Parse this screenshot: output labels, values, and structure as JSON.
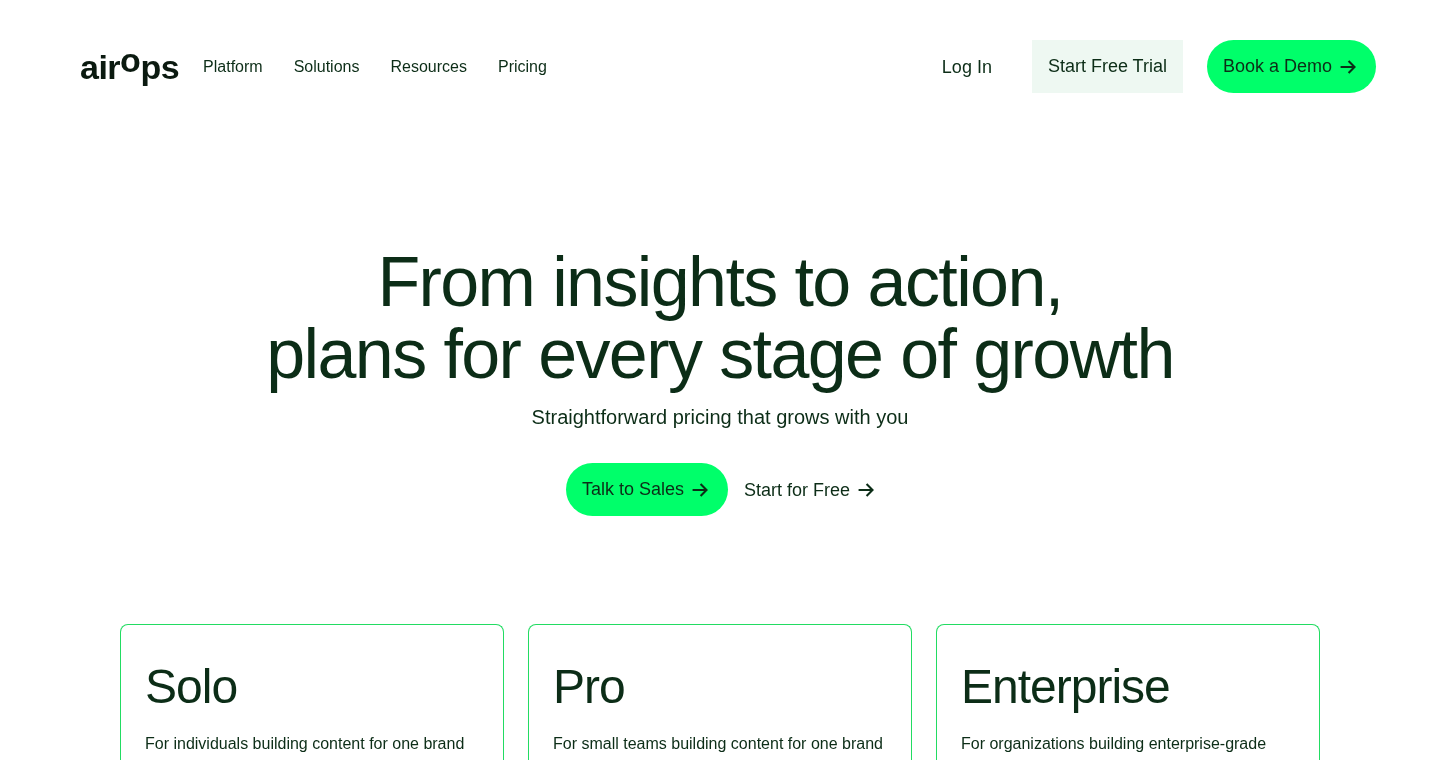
{
  "header": {
    "logo": "air$^{o}$ps",
    "nav": [
      {
        "label": "Platform"
      },
      {
        "label": "Solutions"
      },
      {
        "label": "Resources"
      },
      {
        "label": "Pricing"
      }
    ],
    "actions": [
      {
        "label": "Log In",
        "kind": "link",
        "arrow": false
      },
      {
        "label": "Start Free Trial",
        "kind": "secondary",
        "arrow": false
      },
      {
        "label": "Book a Demo",
        "kind": "primary",
        "arrow": true
      }
    ]
  },
  "hero": {
    "title_lines": [
      "From insights to action,",
      "plans for every stage of growth"
    ],
    "subtitle": "Straightforward pricing that grows with you",
    "buttons": [
      {
        "label": "Talk to Sales",
        "kind": "primary",
        "arrow": true
      },
      {
        "label": "Start for Free",
        "kind": "link",
        "arrow": true
      }
    ]
  },
  "plans": [
    {
      "name": "Solo",
      "description": "For individuals building content for one brand"
    },
    {
      "name": "Pro",
      "description": "For small teams building content for one brand"
    },
    {
      "name": "Enterprise",
      "description": "For organizations building enterprise-grade"
    }
  ]
}
